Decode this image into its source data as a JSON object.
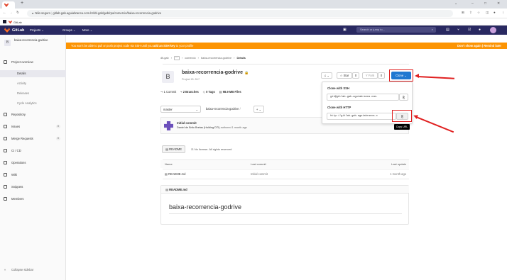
{
  "browser": {
    "url_warning": "Não seguro",
    "url": "gitlab-gab.aguiabranca.com.br/dti-gab/gab/rpa/comercio/baixa-recorrencia-godrive",
    "bookmark_label": "GitLab"
  },
  "header": {
    "logo_text": "GitLab",
    "menu": [
      "Projects",
      "Groups",
      "More"
    ],
    "search_placeholder": "Search or jump to..."
  },
  "sidebar": {
    "project_initial": "B",
    "project_name": "baixa-recorrencia-godrive",
    "project_overview": "Project overview",
    "sub_items": [
      "Details",
      "Activity",
      "Releases",
      "Cycle Analytics"
    ],
    "items": [
      {
        "label": "Repository",
        "count": ""
      },
      {
        "label": "Issues",
        "count": "0"
      },
      {
        "label": "Merge Requests",
        "count": "0"
      },
      {
        "label": "CI / CD",
        "count": ""
      },
      {
        "label": "Operations",
        "count": ""
      },
      {
        "label": "Wiki",
        "count": ""
      },
      {
        "label": "Snippets",
        "count": ""
      },
      {
        "label": "Members",
        "count": ""
      }
    ],
    "collapse_label": "Collapse sidebar"
  },
  "banner": {
    "text_pre": "You won't be able to pull or push project code via SSH until you ",
    "text_link": "add an SSH key",
    "text_post": " to your profile",
    "dont_show": "Don't show again",
    "remind_later": "Remind later"
  },
  "breadcrumb": [
    "dti-gab",
    "comercio",
    "baixa-recorrencia-godrive",
    "Details"
  ],
  "project": {
    "avatar": "B",
    "name": "baixa-recorrencia-godrive",
    "id_label": "Project ID: 517",
    "stats": {
      "commits": "1 Commit",
      "branches": "2 Branches",
      "tags": "0 Tags",
      "files": "98.9 MB Files"
    },
    "star_label": "Star",
    "star_count": "0",
    "fork_label": "Fork",
    "fork_count": "0",
    "clone_label": "Clone"
  },
  "repo_controls": {
    "branch": "master",
    "path": "baixa-recorrencia-godrive",
    "add": "+"
  },
  "commit": {
    "title": "Initial commit",
    "author": "Daniel de Brito Bretas (Holding DTI)",
    "meta": "authored 1 month ago",
    "sha_partial": "b"
  },
  "files_tabs": {
    "readme": "README",
    "license": "No license. All rights reserved"
  },
  "table": {
    "headers": [
      "Name",
      "Last commit",
      "Last update"
    ],
    "rows": [
      {
        "name": "README.md",
        "commit": "Initial commit",
        "update": "1 month ago"
      }
    ]
  },
  "readme": {
    "file": "README.md",
    "heading": "baixa-recorrencia-godrive"
  },
  "clone_dropdown": {
    "ssh_title": "Clone with SSH",
    "ssh_url": "git@gitlab-gab.aguiabranca.com.",
    "http_title": "Clone with HTTP",
    "http_url": "http://gitlab-gab.aguiabranca.c",
    "tooltip": "Copy URL"
  },
  "colors": {
    "header": "#292961",
    "banner": "#fc9403",
    "clone_button": "#1f78d1",
    "annotation": "#e02020"
  }
}
